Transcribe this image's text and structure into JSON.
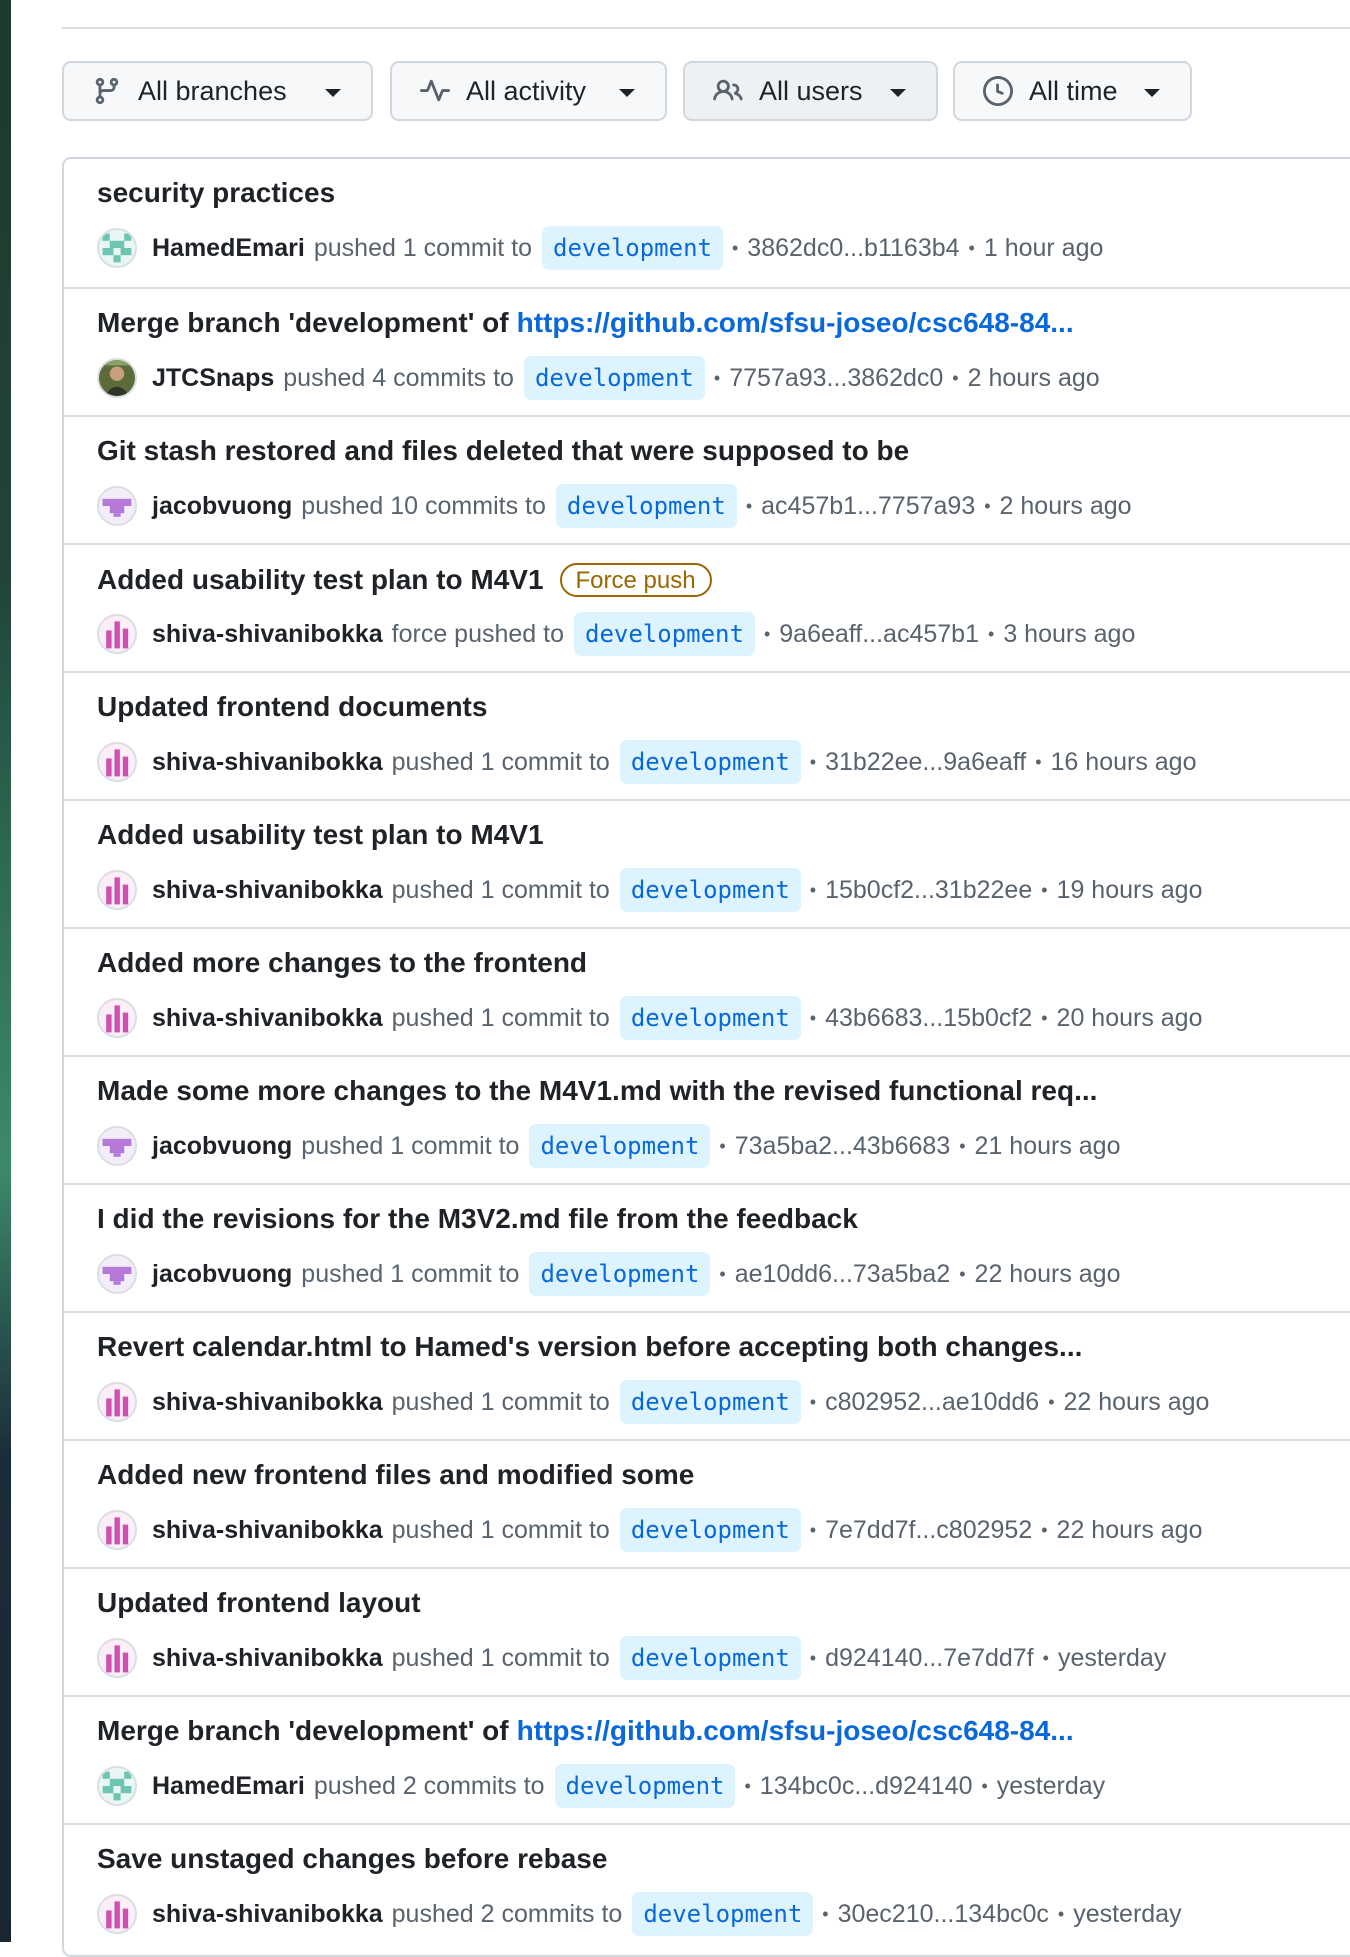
{
  "filters": [
    {
      "label": "All branches",
      "icon": "git-branch-icon"
    },
    {
      "label": "All activity",
      "icon": "pulse-icon"
    },
    {
      "label": "All users",
      "icon": "people-icon"
    },
    {
      "label": "All time",
      "icon": "clock-icon"
    }
  ],
  "activity": [
    {
      "title": "security practices",
      "title_link": "",
      "badge": "",
      "user": "HamedEmari",
      "avatar": "teal-identicon",
      "action": "pushed 1 commit to",
      "branch": "development",
      "range": "3862dc0...b1163b4",
      "time": "1 hour ago"
    },
    {
      "title": "Merge branch 'development' of",
      "title_link": "https://github.com/sfsu-joseo/csc648-84...",
      "badge": "",
      "user": "JTCSnaps",
      "avatar": "photo",
      "action": "pushed 4 commits to",
      "branch": "development",
      "range": "7757a93...3862dc0",
      "time": "2 hours ago"
    },
    {
      "title": "Git stash restored and files deleted that were supposed to be",
      "title_link": "",
      "badge": "",
      "user": "jacobvuong",
      "avatar": "purple-identicon",
      "action": "pushed 10 commits to",
      "branch": "development",
      "range": "ac457b1...7757a93",
      "time": "2 hours ago"
    },
    {
      "title": "Added usability test plan to M4V1",
      "title_link": "",
      "badge": "Force push",
      "user": "shiva-shivanibokka",
      "avatar": "pink-identicon",
      "action": "force pushed to",
      "branch": "development",
      "range": "9a6eaff...ac457b1",
      "time": "3 hours ago"
    },
    {
      "title": "Updated frontend documents",
      "title_link": "",
      "badge": "",
      "user": "shiva-shivanibokka",
      "avatar": "pink-identicon",
      "action": "pushed 1 commit to",
      "branch": "development",
      "range": "31b22ee...9a6eaff",
      "time": "16 hours ago"
    },
    {
      "title": "Added usability test plan to M4V1",
      "title_link": "",
      "badge": "",
      "user": "shiva-shivanibokka",
      "avatar": "pink-identicon",
      "action": "pushed 1 commit to",
      "branch": "development",
      "range": "15b0cf2...31b22ee",
      "time": "19 hours ago"
    },
    {
      "title": "Added more changes to the frontend",
      "title_link": "",
      "badge": "",
      "user": "shiva-shivanibokka",
      "avatar": "pink-identicon",
      "action": "pushed 1 commit to",
      "branch": "development",
      "range": "43b6683...15b0cf2",
      "time": "20 hours ago"
    },
    {
      "title": "Made some more changes to the M4V1.md with the revised functional req...",
      "title_link": "",
      "badge": "",
      "user": "jacobvuong",
      "avatar": "purple-identicon",
      "action": "pushed 1 commit to",
      "branch": "development",
      "range": "73a5ba2...43b6683",
      "time": "21 hours ago"
    },
    {
      "title": "I did the revisions for the M3V2.md file from the feedback",
      "title_link": "",
      "badge": "",
      "user": "jacobvuong",
      "avatar": "purple-identicon",
      "action": "pushed 1 commit to",
      "branch": "development",
      "range": "ae10dd6...73a5ba2",
      "time": "22 hours ago"
    },
    {
      "title": "Revert calendar.html to Hamed's version before accepting both changes...",
      "title_link": "",
      "badge": "",
      "user": "shiva-shivanibokka",
      "avatar": "pink-identicon",
      "action": "pushed 1 commit to",
      "branch": "development",
      "range": "c802952...ae10dd6",
      "time": "22 hours ago"
    },
    {
      "title": "Added new frontend files and modified some",
      "title_link": "",
      "badge": "",
      "user": "shiva-shivanibokka",
      "avatar": "pink-identicon",
      "action": "pushed 1 commit to",
      "branch": "development",
      "range": "7e7dd7f...c802952",
      "time": "22 hours ago"
    },
    {
      "title": "Updated frontend layout",
      "title_link": "",
      "badge": "",
      "user": "shiva-shivanibokka",
      "avatar": "pink-identicon",
      "action": "pushed 1 commit to",
      "branch": "development",
      "range": "d924140...7e7dd7f",
      "time": "yesterday"
    },
    {
      "title": "Merge branch 'development' of",
      "title_link": "https://github.com/sfsu-joseo/csc648-84...",
      "badge": "",
      "user": "HamedEmari",
      "avatar": "teal-identicon",
      "action": "pushed 2 commits to",
      "branch": "development",
      "range": "134bc0c...d924140",
      "time": "yesterday"
    },
    {
      "title": "Save unstaged changes before rebase",
      "title_link": "",
      "badge": "",
      "user": "shiva-shivanibokka",
      "avatar": "pink-identicon",
      "action": "pushed 2 commits to",
      "branch": "development",
      "range": "30ec210...134bc0c",
      "time": "yesterday"
    }
  ],
  "colors": {
    "link": "#0969da",
    "branch_bg": "#ddf4ff",
    "badge": "#9a6700",
    "border": "#d0d7de",
    "teal": "#6cc6b2",
    "purple": "#b57ad8",
    "pink": "#d04fb0"
  }
}
